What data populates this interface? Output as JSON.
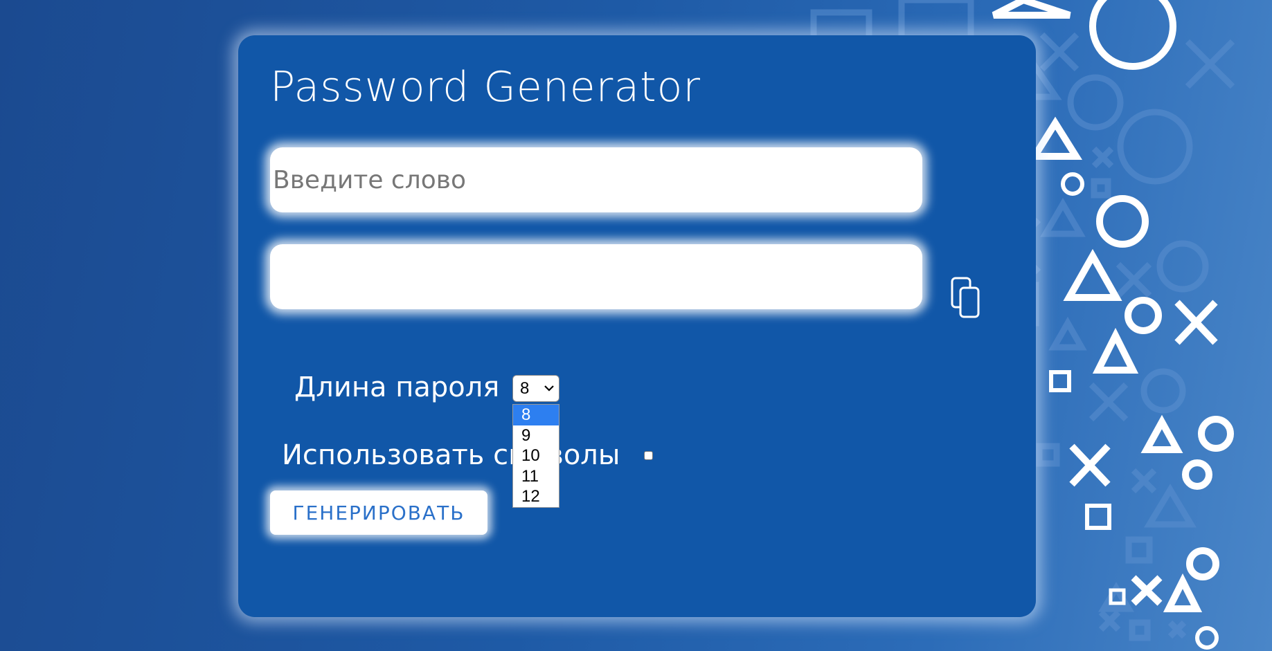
{
  "app": {
    "title": "Password Generator"
  },
  "form": {
    "word_placeholder": "Введите слово",
    "word_value": "",
    "result_value": "",
    "length_label": "Длина пароля",
    "length_selected": "8",
    "length_options": [
      "8",
      "9",
      "10",
      "11",
      "12"
    ],
    "symbols_label": "Использовать символы",
    "symbols_checked": false,
    "generate_label": "ГЕНЕРИРОВАТЬ"
  },
  "icons": {
    "copy": "copy-icon",
    "chevron": "chevron-down-icon"
  },
  "colors": {
    "card": "#1157a8",
    "background": "#1e5aa6",
    "button_text": "#2a70c9",
    "selected_option": "#2d7ff0"
  }
}
